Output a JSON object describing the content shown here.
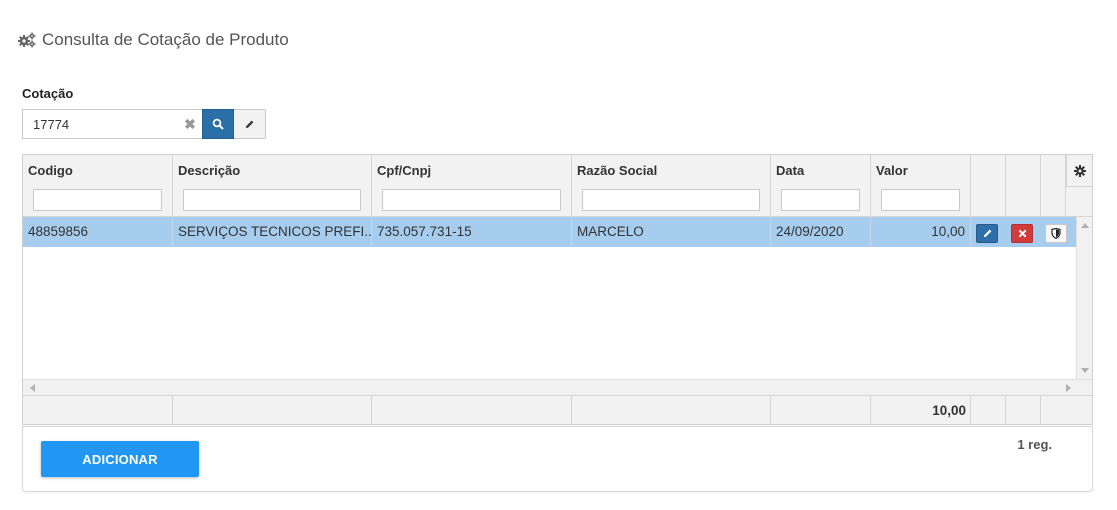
{
  "page": {
    "title": "Consulta de Cotação de Produto",
    "icon": "gears-icon"
  },
  "lookup": {
    "label": "Cotação",
    "value": "17774",
    "clear_symbol": "✖"
  },
  "grid": {
    "columns": [
      {
        "key": "codigo",
        "label": "Codigo"
      },
      {
        "key": "descricao",
        "label": "Descrição"
      },
      {
        "key": "cpf_cnpj",
        "label": "Cpf/Cnpj"
      },
      {
        "key": "razao_social",
        "label": "Razão Social"
      },
      {
        "key": "data",
        "label": "Data"
      },
      {
        "key": "valor",
        "label": "Valor"
      }
    ],
    "rows": [
      {
        "codigo": "48859856",
        "descricao": "SERVIÇOS TECNICOS PREFI...",
        "cpf_cnpj": "735.057.731-15",
        "razao_social": "MARCELO",
        "data": "24/09/2020",
        "valor": "10,00",
        "selected": true
      }
    ],
    "footer_total": "10,00",
    "selected_row_color": "#a6cdee"
  },
  "actions": {
    "add_label": "ADICIONAR",
    "record_count": "1 reg."
  },
  "colors": {
    "primary": "#2196f3",
    "edit": "#2f6ea9",
    "delete": "#d23b3b",
    "header_bg": "#f2f2f2"
  }
}
